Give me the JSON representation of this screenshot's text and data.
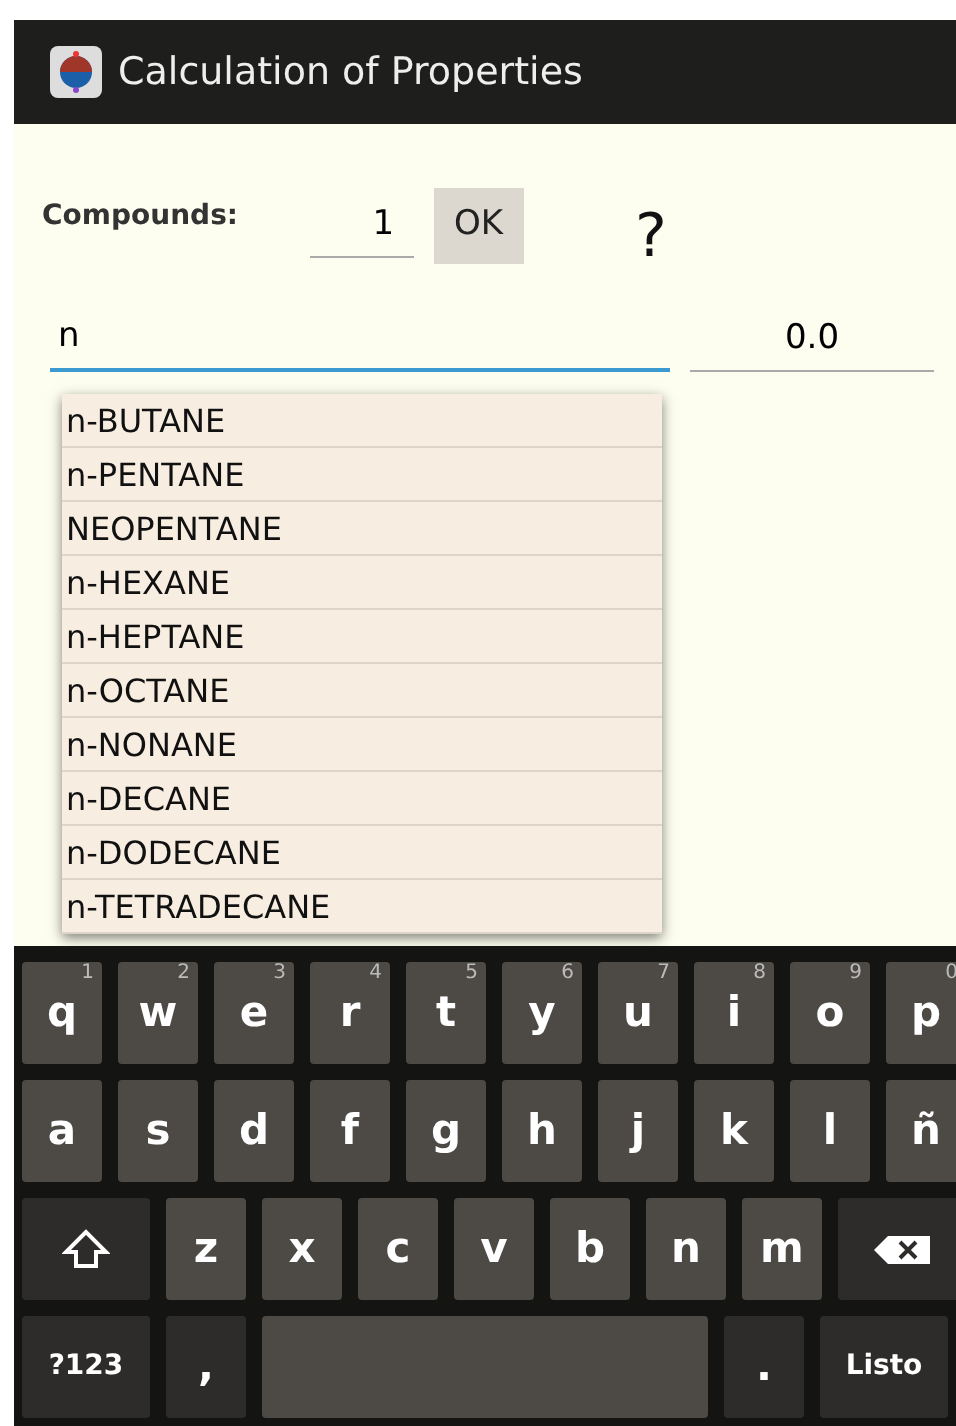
{
  "title_bar": {
    "title": "Calculation of Properties"
  },
  "compounds": {
    "label": "Compounds:",
    "count": "1",
    "ok_button": "OK",
    "help": "?"
  },
  "search": {
    "value": "n",
    "focused": true
  },
  "result": {
    "value": "0.0"
  },
  "suggestions": [
    {
      "label": "n-BUTANE"
    },
    {
      "label": "n-PENTANE"
    },
    {
      "label": "NEOPENTANE"
    },
    {
      "label": "n-HEXANE"
    },
    {
      "label": "n-HEPTANE"
    },
    {
      "label": "n-OCTANE"
    },
    {
      "label": "n-NONANE"
    },
    {
      "label": "n-DECANE"
    },
    {
      "label": "n-DODECANE"
    },
    {
      "label": "n-TETRADECANE"
    }
  ],
  "keyboard": {
    "rows": [
      {
        "keys": [
          {
            "kind": "letter",
            "label": "q",
            "hint": "1"
          },
          {
            "kind": "letter",
            "label": "w",
            "hint": "2"
          },
          {
            "kind": "letter",
            "label": "e",
            "hint": "3"
          },
          {
            "kind": "letter",
            "label": "r",
            "hint": "4"
          },
          {
            "kind": "letter",
            "label": "t",
            "hint": "5"
          },
          {
            "kind": "letter",
            "label": "y",
            "hint": "6"
          },
          {
            "kind": "letter",
            "label": "u",
            "hint": "7"
          },
          {
            "kind": "letter",
            "label": "i",
            "hint": "8"
          },
          {
            "kind": "letter",
            "label": "o",
            "hint": "9"
          },
          {
            "kind": "letter",
            "label": "p",
            "hint": "0"
          }
        ]
      },
      {
        "keys": [
          {
            "kind": "letter",
            "label": "a"
          },
          {
            "kind": "letter",
            "label": "s"
          },
          {
            "kind": "letter",
            "label": "d"
          },
          {
            "kind": "letter",
            "label": "f"
          },
          {
            "kind": "letter",
            "label": "g"
          },
          {
            "kind": "letter",
            "label": "h"
          },
          {
            "kind": "letter",
            "label": "j"
          },
          {
            "kind": "letter",
            "label": "k"
          },
          {
            "kind": "letter",
            "label": "l"
          },
          {
            "kind": "letter",
            "label": "ñ"
          }
        ]
      },
      {
        "keys": [
          {
            "kind": "shift"
          },
          {
            "kind": "letter",
            "label": "z"
          },
          {
            "kind": "letter",
            "label": "x"
          },
          {
            "kind": "letter",
            "label": "c"
          },
          {
            "kind": "letter",
            "label": "v"
          },
          {
            "kind": "letter",
            "label": "b"
          },
          {
            "kind": "letter",
            "label": "n"
          },
          {
            "kind": "letter",
            "label": "m"
          },
          {
            "kind": "backspace"
          }
        ]
      },
      {
        "keys": [
          {
            "kind": "mode",
            "label": "?123"
          },
          {
            "kind": "punct",
            "label": ","
          },
          {
            "kind": "space"
          },
          {
            "kind": "punct",
            "label": "."
          },
          {
            "kind": "action",
            "label": "Listo"
          }
        ]
      }
    ]
  }
}
